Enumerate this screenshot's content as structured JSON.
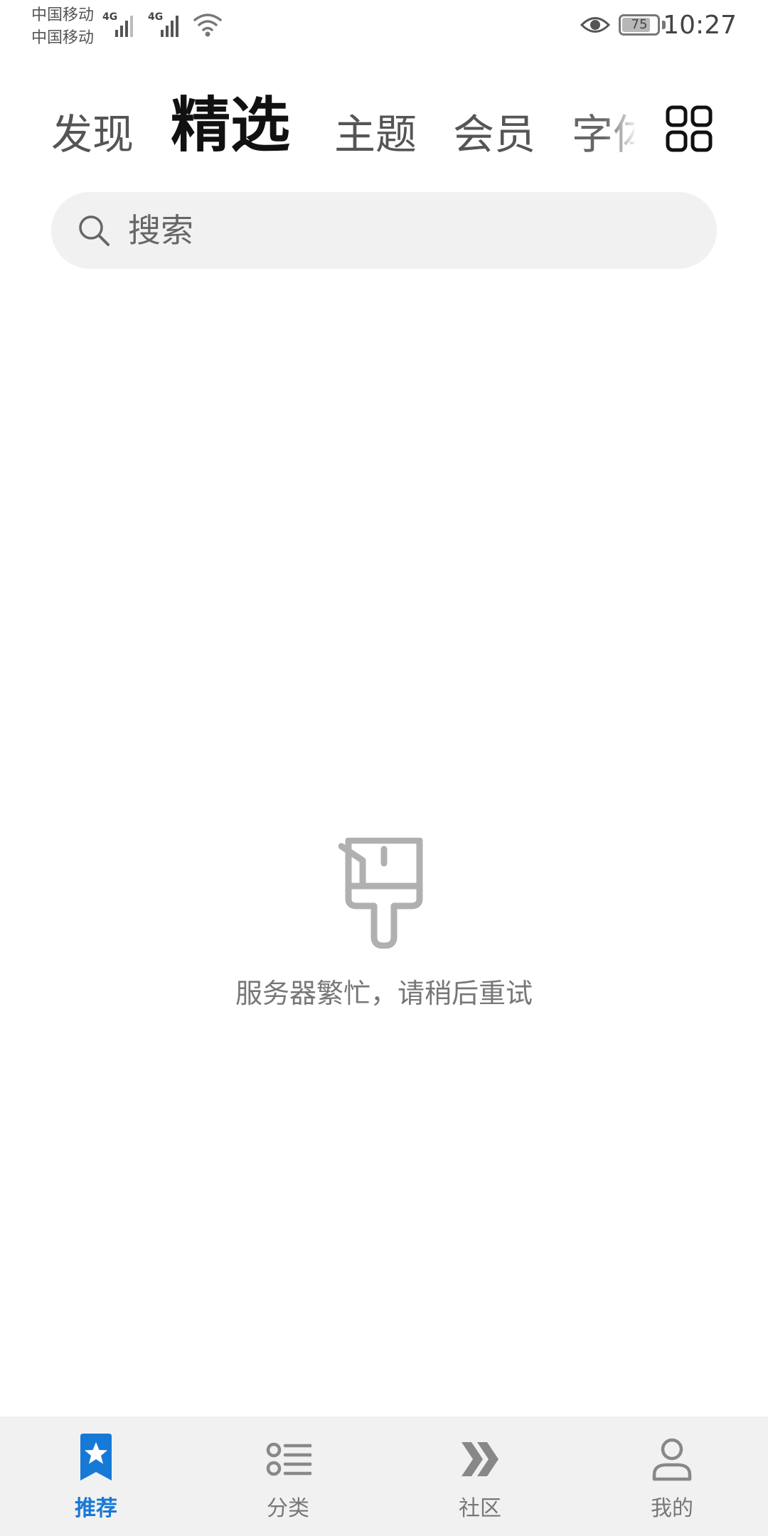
{
  "status_bar": {
    "carrier_1": "中国移动",
    "carrier_2": "中国移动",
    "network_1": "4G",
    "network_2": "4G",
    "battery_level": "75",
    "time": "10:27"
  },
  "tabs": [
    {
      "label": "发现",
      "active": false
    },
    {
      "label": "精选",
      "active": true
    },
    {
      "label": "主题",
      "active": false
    },
    {
      "label": "会员",
      "active": false
    },
    {
      "label": "字体",
      "active": false
    }
  ],
  "search": {
    "placeholder": "搜索"
  },
  "empty_state": {
    "message": "服务器繁忙，请稍后重试"
  },
  "bottom_nav": [
    {
      "label": "推荐",
      "icon": "star-bookmark-icon",
      "active": true
    },
    {
      "label": "分类",
      "icon": "category-list-icon",
      "active": false
    },
    {
      "label": "社区",
      "icon": "double-chevron-icon",
      "active": false
    },
    {
      "label": "我的",
      "icon": "person-icon",
      "active": false
    }
  ],
  "colors": {
    "accent": "#1779d6",
    "nav_background": "#f1f1f1",
    "search_background": "#f1f1f1",
    "muted_text": "#777777"
  }
}
